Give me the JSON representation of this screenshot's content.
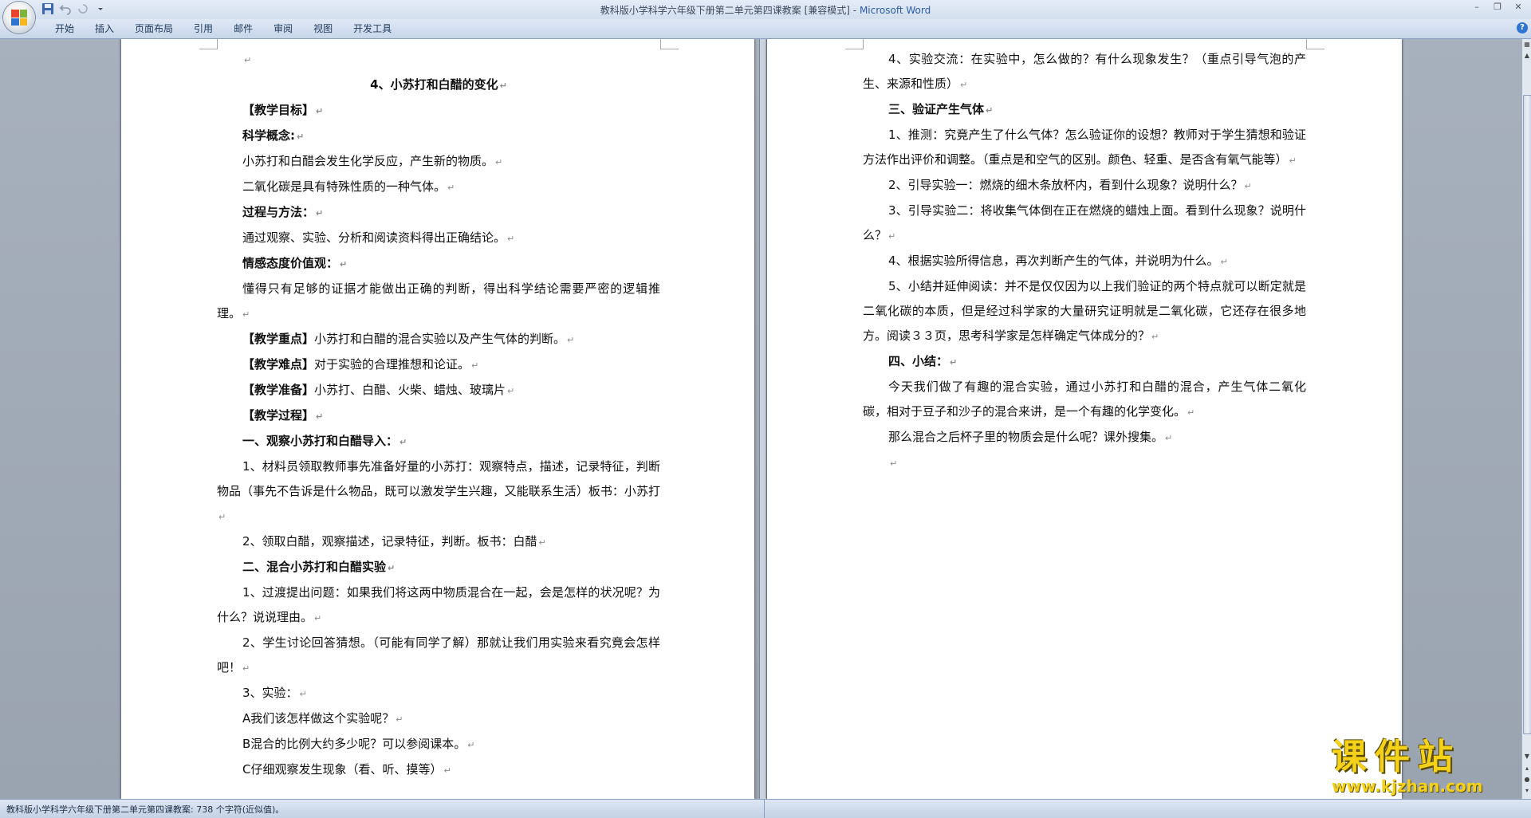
{
  "window": {
    "document_title": "教科版小学科学六年级下册第二单元第四课教案 [兼容模式]",
    "title_separator": " - ",
    "app_name": "Microsoft Word"
  },
  "ribbon": {
    "tabs": [
      "开始",
      "插入",
      "页面布局",
      "引用",
      "邮件",
      "审阅",
      "视图",
      "开发工具"
    ]
  },
  "document": {
    "left_page": [
      {
        "style": "blank",
        "text": ""
      },
      {
        "style": "center",
        "text": "4、小苏打和白醋的变化"
      },
      {
        "style": "bold-indent",
        "text": "【教学目标】"
      },
      {
        "style": "bold-indent",
        "text": "科学概念:"
      },
      {
        "style": "indent",
        "text": "小苏打和白醋会发生化学反应，产生新的物质。"
      },
      {
        "style": "indent",
        "text": "二氧化碳是具有特殊性质的一种气体。"
      },
      {
        "style": "bold-indent",
        "text": "过程与方法："
      },
      {
        "style": "indent",
        "text": "通过观察、实验、分析和阅读资料得出正确结论。"
      },
      {
        "style": "bold-indent",
        "text": "情感态度价值观："
      },
      {
        "style": "indent",
        "text": "懂得只有足够的证据才能做出正确的判断，得出科学结论需要严密的逻辑推理。"
      },
      {
        "style": "label-indent",
        "label": "【教学重点】",
        "text": "小苏打和白醋的混合实验以及产生气体的判断。"
      },
      {
        "style": "label-indent",
        "label": "【教学难点】",
        "text": "对于实验的合理推想和论证。"
      },
      {
        "style": "label-indent",
        "label": "【教学准备】",
        "text": "小苏打、白醋、火柴、蜡烛、玻璃片"
      },
      {
        "style": "bold-indent",
        "text": "【教学过程】"
      },
      {
        "style": "bold-indent",
        "text": "一、观察小苏打和白醋导入："
      },
      {
        "style": "indent",
        "text": "1、材料员领取教师事先准备好量的小苏打：观察特点，描述，记录特征，判断物品（事先不告诉是什么物品，既可以激发学生兴趣，又能联系生活）板书：小苏打"
      },
      {
        "style": "indent",
        "text": "2、领取白醋，观察描述，记录特征，判断。板书：白醋"
      },
      {
        "style": "bold-indent",
        "text": "二、混合小苏打和白醋实验"
      },
      {
        "style": "indent",
        "text": "1、过渡提出问题：如果我们将这两中物质混合在一起，会是怎样的状况呢？为什么？说说理由。"
      },
      {
        "style": "indent",
        "text": "2、学生讨论回答猜想。（可能有同学了解）那就让我们用实验来看究竟会怎样吧！"
      },
      {
        "style": "indent",
        "text": "3、实验："
      },
      {
        "style": "indent",
        "text": "A我们该怎样做这个实验呢？"
      },
      {
        "style": "indent",
        "text": "B混合的比例大约多少呢？可以参阅课本。"
      },
      {
        "style": "indent",
        "text": "C仔细观察发生现象（看、听、摸等）"
      }
    ],
    "right_page": [
      {
        "style": "indent",
        "text": "4、实验交流：在实验中，怎么做的？有什么现象发生？（重点引导气泡的产生、来源和性质）"
      },
      {
        "style": "bold-indent",
        "text": "三、验证产生气体"
      },
      {
        "style": "indent",
        "text": "1、推测：究竟产生了什么气体？怎么验证你的设想？教师对于学生猜想和验证方法作出评价和调整。（重点是和空气的区别。颜色、轻重、是否含有氧气能等）"
      },
      {
        "style": "indent",
        "text": "2、引导实验一：燃烧的细木条放杯内，看到什么现象？说明什么？"
      },
      {
        "style": "indent",
        "text": "3、引导实验二：将收集气体倒在正在燃烧的蜡烛上面。看到什么现象？说明什么？"
      },
      {
        "style": "indent",
        "text": "4、根据实验所得信息，再次判断产生的气体，并说明为什么。"
      },
      {
        "style": "indent",
        "text": "5、小结并延伸阅读：并不是仅仅因为以上我们验证的两个特点就可以断定就是二氧化碳的本质，但是经过科学家的大量研究证明就是二氧化碳，它还存在很多地方。阅读３３页，思考科学家是怎样确定气体成分的？"
      },
      {
        "style": "bold-indent",
        "text": "四、小结："
      },
      {
        "style": "indent",
        "text": "今天我们做了有趣的混合实验，通过小苏打和白醋的混合，产生气体二氧化碳，相对于豆子和沙子的混合来讲，是一个有趣的化学变化。"
      },
      {
        "style": "indent",
        "text": "那么混合之后杯子里的物质会是什么呢？课外搜集。"
      },
      {
        "style": "blank",
        "text": ""
      }
    ]
  },
  "status_bar": {
    "text": "教科版小学科学六年级下册第二单元第四课教案: 738 个字符(近似值)。"
  },
  "watermark": {
    "title": "课件站",
    "url": "www.kjzhan.com"
  },
  "colors": {
    "title_accent": "#2a5ca8",
    "watermark": "#f5d21a",
    "workspace": "#9ea6b2"
  }
}
